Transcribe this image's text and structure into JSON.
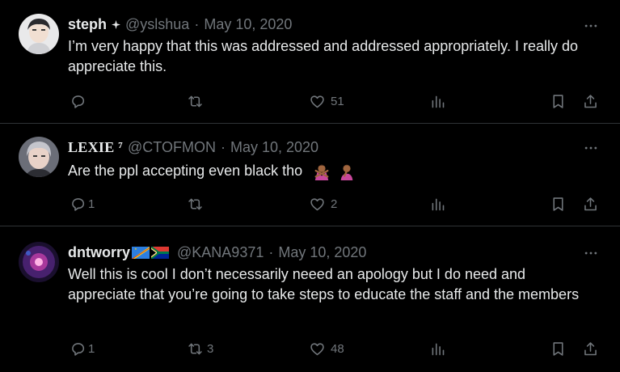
{
  "tweets": [
    {
      "name": "steph",
      "handle": "@yslshua",
      "date": "May 10, 2020",
      "text": "I’m very happy that this was addressed and addressed appropriately. I really do appreciate this.",
      "replies": "",
      "retweets": "",
      "likes": "51"
    },
    {
      "name": "LEXIE ⁷",
      "handle": "@CTOFMON",
      "date": "May 10, 2020",
      "text": "Are the ppl accepting even black tho",
      "replies": "1",
      "retweets": "",
      "likes": "2"
    },
    {
      "name": "dntworry",
      "handle": "@KANA9371",
      "date": "May 10, 2020",
      "text": "Well this is cool I don’t necessarily neeed an apology but I do need and appreciate that you’re going to take steps to educate the staff and the members",
      "replies": "1",
      "retweets": "3",
      "likes": "48"
    }
  ],
  "separator": "·",
  "icons": [
    "reply-icon",
    "retweet-icon",
    "like-icon",
    "views-icon",
    "bookmark-icon",
    "share-icon",
    "more-icon"
  ],
  "colors": {
    "background": "#000000",
    "text": "#e7e9ea",
    "muted": "#71767b",
    "divider": "#2f3336"
  }
}
